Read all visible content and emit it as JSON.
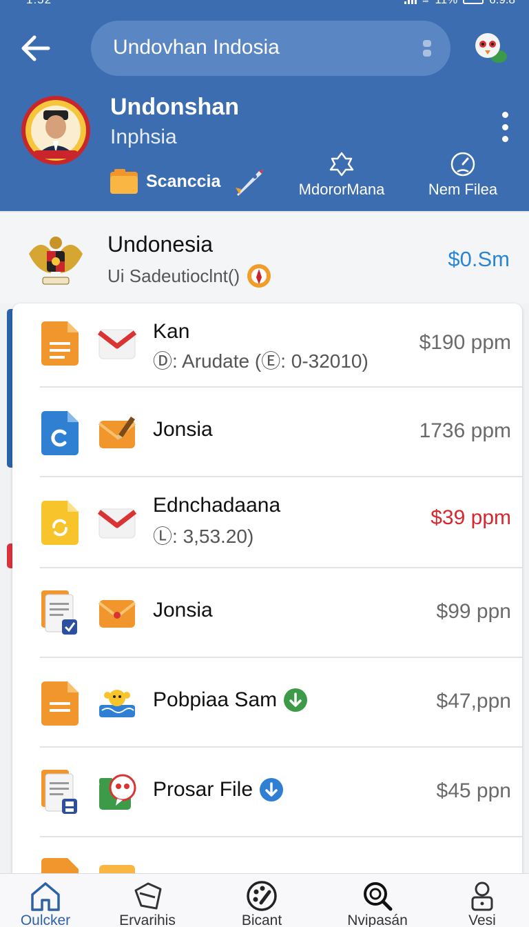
{
  "status_bar": {
    "time": "1:52",
    "battery": "11%",
    "right_text": "6.9.8"
  },
  "search": {
    "value": "Undovhan Indosia"
  },
  "channel": {
    "title": "Undonshan",
    "subtitle": "Inphsia",
    "action_label": "Scanccia",
    "col1_label": "MdororMana",
    "col2_label": "Nem Filea"
  },
  "info": {
    "name": "Undonesia",
    "sub": "Ui Sadeutioclnt()",
    "price": "$0.Sm"
  },
  "files": [
    {
      "name": "Kan",
      "meta_prefix": "Ⓓ:",
      "meta": "Arudate (Ⓔ: 0-32010)",
      "price": "$190 ppm",
      "price_color": "#6a6a6a"
    },
    {
      "name": "Jonsia",
      "price": "1736 ppm",
      "price_color": "#6a6a6a"
    },
    {
      "name": "Ednchadaana",
      "meta_prefix": "Ⓛ:",
      "meta": "3,53.20)",
      "price": "$39 ppm",
      "price_color": "#d7272d"
    },
    {
      "name": "Jonsia",
      "price": "$99 ppn",
      "price_color": "#6a6a6a"
    },
    {
      "name": "Pobpiaa Sam",
      "price": "$47,ppn",
      "price_color": "#6a6a6a"
    },
    {
      "name": "Prosar File",
      "price": "$45 ppn",
      "price_color": "#6a6a6a"
    }
  ],
  "nav": [
    {
      "label": "Oulcker",
      "icon": "home-icon"
    },
    {
      "label": "Ervarihis",
      "icon": "tag-icon"
    },
    {
      "label": "Bicant",
      "icon": "palette-icon"
    },
    {
      "label": "Nvipasán",
      "icon": "search-icon"
    },
    {
      "label": "Vesi",
      "icon": "user-lock-icon"
    }
  ],
  "colors": {
    "header": "#3d6db1",
    "accent": "#2a86d4",
    "alert": "#d7272d"
  }
}
